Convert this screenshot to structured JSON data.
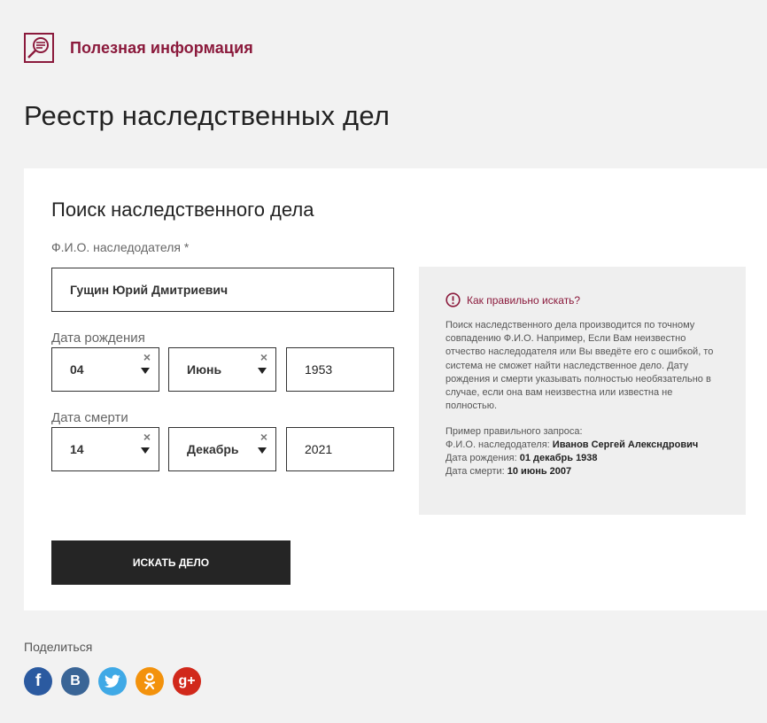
{
  "header": {
    "useful_label": "Полезная информация",
    "page_title": "Реестр наследственных дел"
  },
  "form": {
    "title": "Поиск наследственного дела",
    "fio_label": "Ф.И.О. наследодателя *",
    "fio_value": "Гущин Юрий Дмитриевич",
    "birth_label": "Дата рождения",
    "birth_day": "04",
    "birth_month": "Июнь",
    "birth_year": "1953",
    "death_label": "Дата смерти",
    "death_day": "14",
    "death_month": "Декабрь",
    "death_year": "2021",
    "clear_symbol": "×",
    "submit_label": "ИСКАТЬ ДЕЛО"
  },
  "help": {
    "title": "Как правильно искать?",
    "body": "Поиск наследственного дела производится по точному совпадению Ф.И.О. Например, Если Вам неизвестно отчество наследодателя или Вы введёте его с ошибкой, то система не сможет найти наследственное дело. Дату рождения и смерти указывать полностью необязательно в случае, если она вам неизвестна или известна не полностью.",
    "example_heading": "Пример правильного запроса:",
    "example_fio_label": "Ф.И.О. наследодателя: ",
    "example_fio_value": "Иванов Сергей Алексндрович",
    "example_birth_label": "Дата рождения: ",
    "example_birth_value": "01 декабрь 1938",
    "example_death_label": "Дата смерти: ",
    "example_death_value": "10 июнь 2007"
  },
  "share": {
    "label": "Поделиться",
    "facebook": "f",
    "vk": "B",
    "google": "g+"
  },
  "colors": {
    "accent": "#8b1a3c",
    "button": "#252525",
    "facebook": "#2b5aa0",
    "vk": "#3a6596",
    "twitter": "#3fa9e6",
    "odnoklassniki": "#f3920c",
    "google": "#d1291b"
  },
  "icons": {
    "useful": "magnifier-document-icon",
    "help": "info-circle-icon",
    "select_clear": "close-icon",
    "select_toggle": "chevron-down-icon"
  }
}
